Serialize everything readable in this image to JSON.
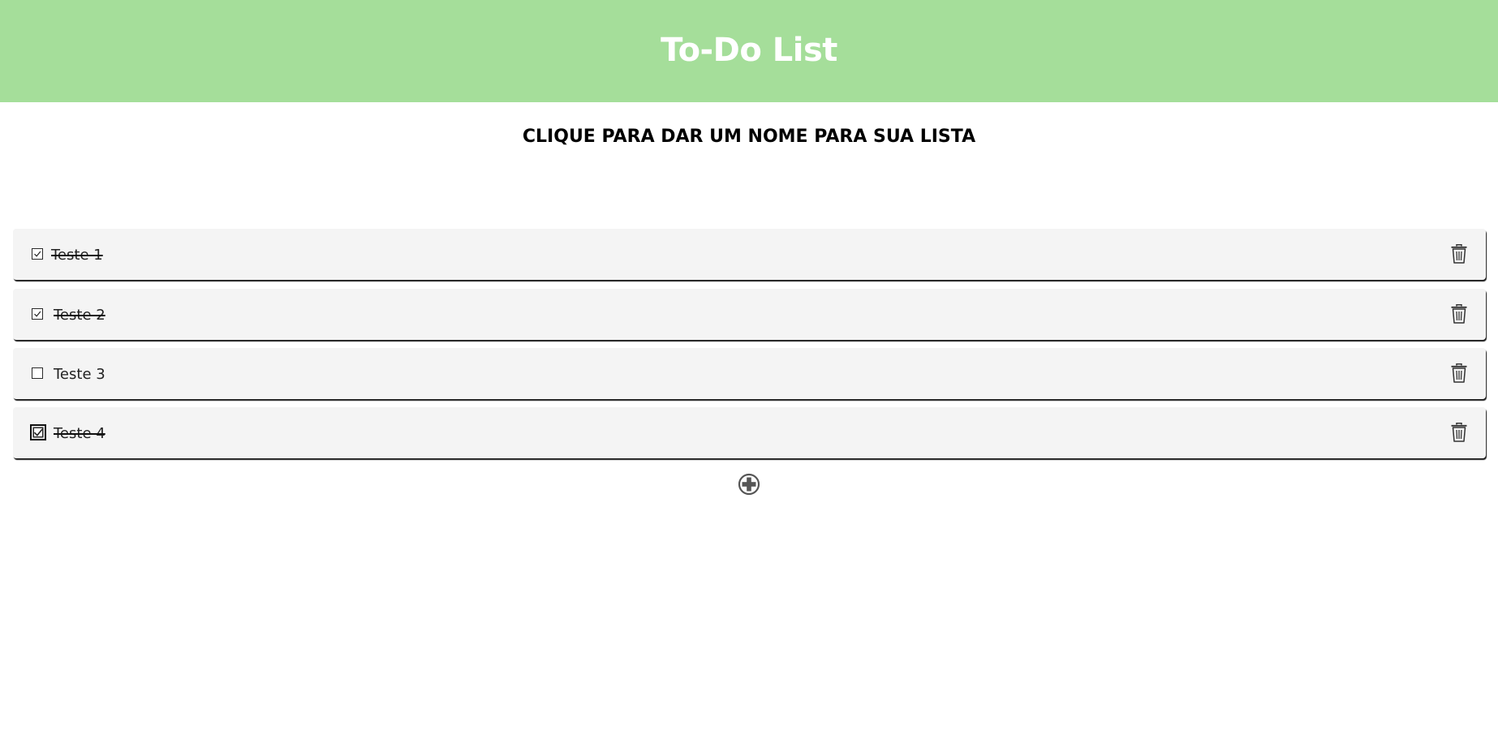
{
  "header": {
    "title": "To-Do List",
    "background_color": "#a5de9a",
    "title_color": "#ffffff"
  },
  "list": {
    "name_placeholder": "CLIQUE PARA DAR UM NOME PARA SUA LISTA"
  },
  "tasks": [
    {
      "label": "Teste 1",
      "done": true,
      "focused": false,
      "checkbox_icon": "checked-box-icon",
      "delete_icon": "trash-icon"
    },
    {
      "label": "Teste 2",
      "done": true,
      "focused": false,
      "checkbox_icon": "checked-box-icon",
      "delete_icon": "trash-icon"
    },
    {
      "label": "Teste 3",
      "done": false,
      "focused": false,
      "checkbox_icon": "empty-box-icon",
      "delete_icon": "trash-icon"
    },
    {
      "label": "Teste 4",
      "done": true,
      "focused": true,
      "checkbox_icon": "checked-box-icon",
      "delete_icon": "trash-icon"
    }
  ],
  "add_button": {
    "icon": "plus-circle-icon"
  },
  "colors": {
    "task_background": "#f4f4f4",
    "icon_color": "#333333"
  }
}
